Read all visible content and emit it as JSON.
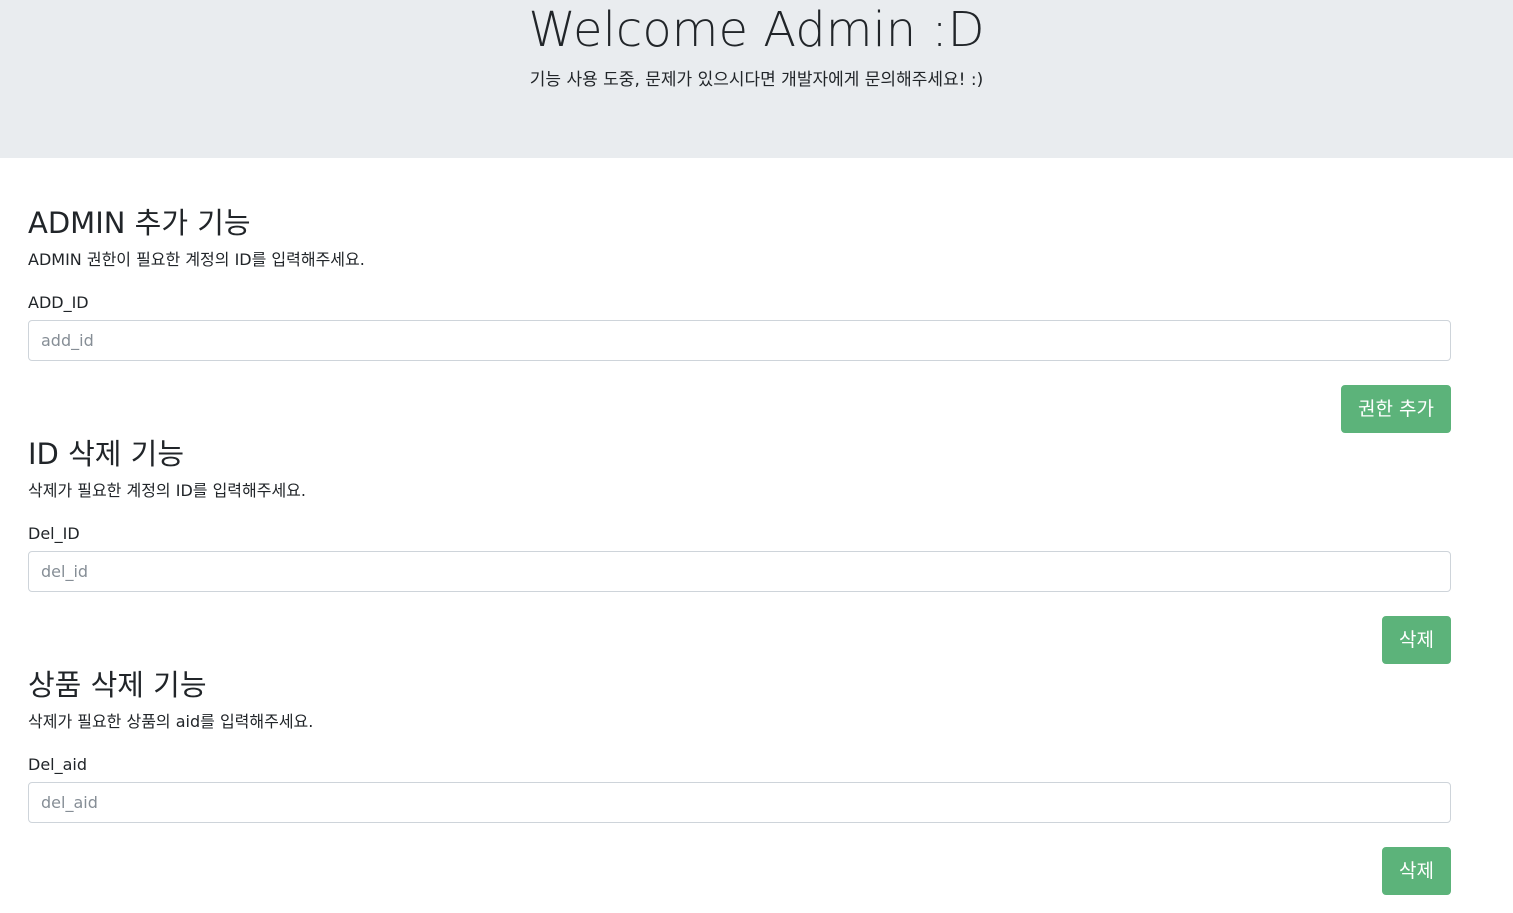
{
  "header": {
    "title": "Welcome Admin :D",
    "subtitle": "기능 사용 도중, 문제가 있으시다면 개발자에게 문의해주세요! :)"
  },
  "sections": [
    {
      "heading": "ADMIN 추가 기능",
      "description": "ADMIN 권한이 필요한 계정의 ID를 입력해주세요.",
      "field_label": "ADD_ID",
      "placeholder": "add_id",
      "value": "",
      "button_label": "권한 추가"
    },
    {
      "heading": "ID 삭제 기능",
      "description": "삭제가 필요한 계정의 ID를 입력해주세요.",
      "field_label": "Del_ID",
      "placeholder": "del_id",
      "value": "",
      "button_label": "삭제"
    },
    {
      "heading": "상품 삭제 기능",
      "description": "삭제가 필요한 상품의 aid를 입력해주세요.",
      "field_label": "Del_aid",
      "placeholder": "del_aid",
      "value": "",
      "button_label": "삭제"
    }
  ],
  "colors": {
    "header_bg": "#e9ecef",
    "button_bg": "#5cb37a",
    "text": "#212529"
  }
}
